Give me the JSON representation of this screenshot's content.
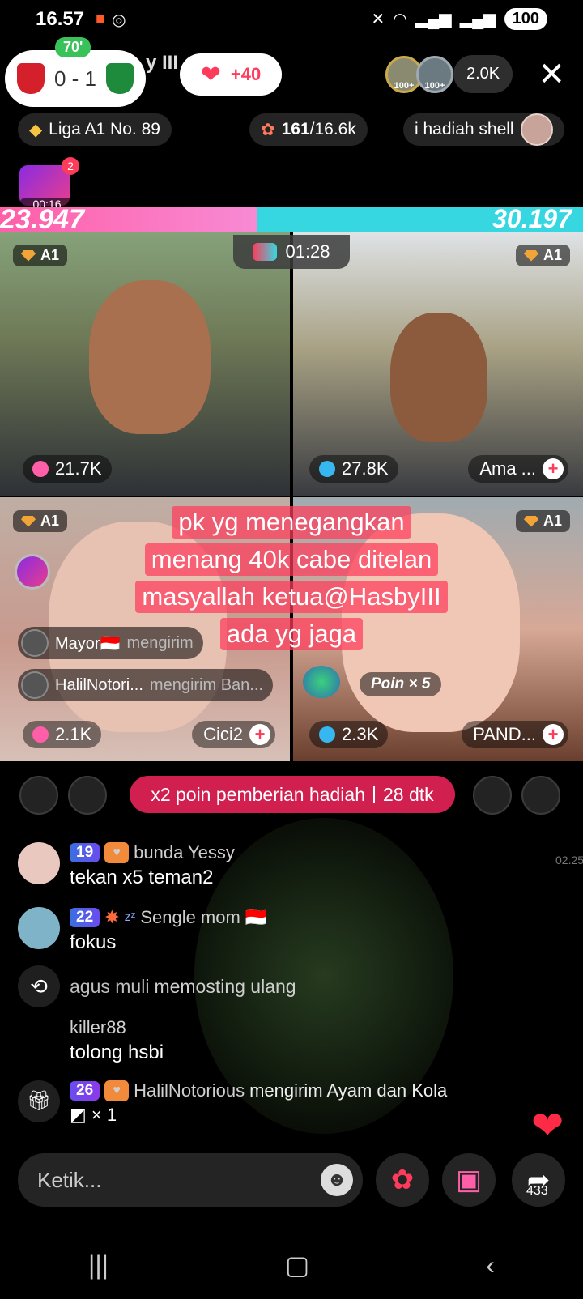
{
  "status_bar": {
    "time": "16.57",
    "battery": "100",
    "icons": [
      "video-record-icon",
      "whatsapp-icon",
      "mute-icon",
      "wifi-icon",
      "signal-icon",
      "signal-icon"
    ]
  },
  "header": {
    "match": {
      "minute": "70'",
      "score": "0 - 1"
    },
    "host_name_fragment": "y III",
    "likes": "+40",
    "viewer_badges": [
      "100+",
      "100+"
    ],
    "viewer_count": "2.0K"
  },
  "chips": {
    "league": "Liga A1 No. 89",
    "shell_current": "161",
    "shell_total": "/16.6k",
    "gift_text": "i hadiah shell"
  },
  "mini_game": {
    "timer": "00:16",
    "badge": "2"
  },
  "pk": {
    "left_score": "23.947",
    "right_score": "30.197",
    "left_share": 0.442,
    "timer": "01:28"
  },
  "tiles": [
    {
      "badge": "A1",
      "count": "21.7K",
      "name": ""
    },
    {
      "badge": "A1",
      "count": "27.8K",
      "name": "Ama ..."
    },
    {
      "badge": "A1",
      "count": "2.1K",
      "name": "Cici2"
    },
    {
      "badge": "A1",
      "count": "2.3K",
      "name": "PAND..."
    }
  ],
  "caption_lines": [
    "pk yg menegangkan",
    "menang 40k cabe ditelan",
    "masyallah ketua@HasbyIII",
    "ada yg jaga"
  ],
  "gift_notices": [
    {
      "user": "Mayor🇮🇩",
      "action": "mengirim"
    },
    {
      "user": "HalilNotori...",
      "action": "mengirim Ban..."
    }
  ],
  "poin": "Poin × 5",
  "x2_banner": {
    "text": "x2 poin pemberian hadiah",
    "countdown": "28 dtk"
  },
  "chat": [
    {
      "level": "19",
      "user": "bunda Yessy",
      "message": "tekan x5 teman2"
    },
    {
      "level": "22",
      "user": "Sengle mom 🇮🇩",
      "message": "fokus"
    },
    {
      "repost_user": "agus muli",
      "repost_action": "memosting ulang"
    },
    {
      "user": "killer88",
      "message": "tolong hsbi"
    },
    {
      "level": "26",
      "user": "HalilNotorious",
      "action": "mengirim Ayam dan Kola",
      "gift_count": "× 1"
    }
  ],
  "side_time": "02.25",
  "input": {
    "placeholder": "Ketik..."
  },
  "share_count": "433"
}
